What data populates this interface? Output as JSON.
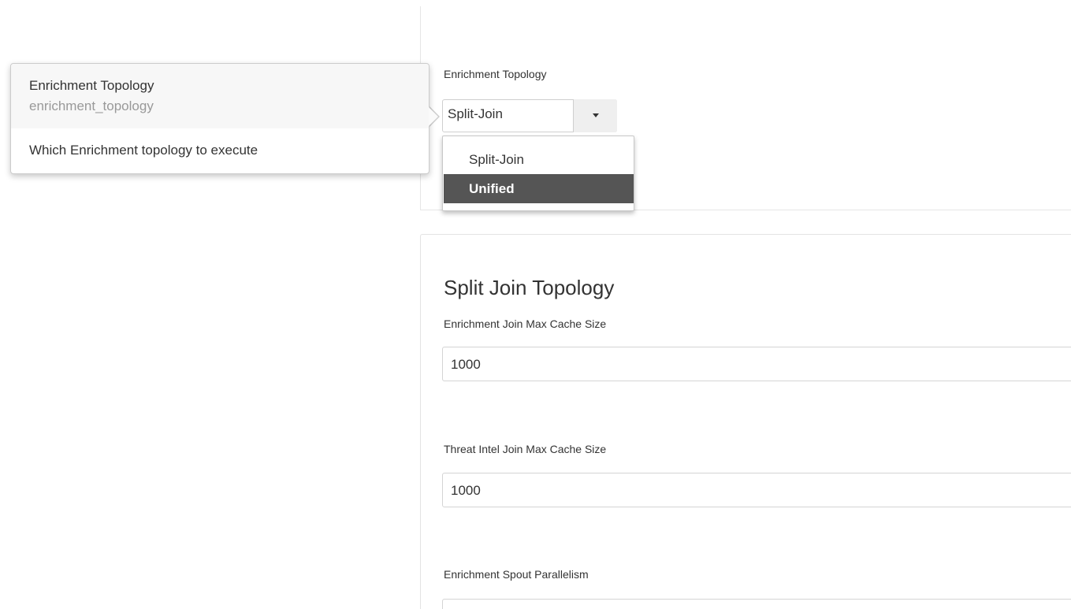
{
  "enrichment": {
    "label": "Enrichment Topology",
    "selected": "Split-Join",
    "options": [
      "Split-Join",
      "Unified"
    ],
    "highlighted_option": "Unified"
  },
  "tooltip": {
    "title": "Enrichment Topology",
    "name": "enrichment_topology",
    "description": "Which Enrichment topology to execute"
  },
  "split_join": {
    "title": "Split Join Topology",
    "fields": [
      {
        "label": "Enrichment Join Max Cache Size",
        "value": "1000"
      },
      {
        "label": "Threat Intel Join Max Cache Size",
        "value": "1000"
      },
      {
        "label": "Enrichment Spout Parallelism",
        "value": ""
      }
    ]
  },
  "colors": {
    "highlight_bg": "#555555",
    "tooltip_header_bg": "#f7f7f7"
  }
}
